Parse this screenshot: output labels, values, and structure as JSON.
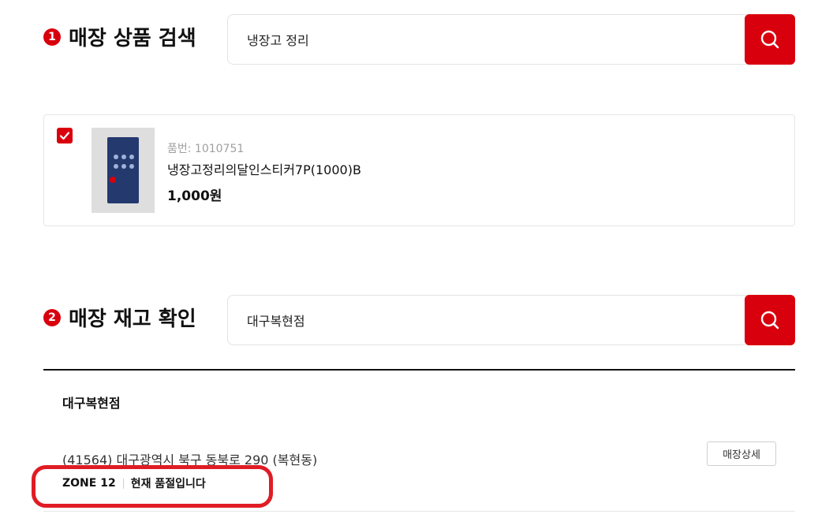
{
  "search_section": {
    "step": "1",
    "title": "매장 상품 검색",
    "query": "냉장고 정리"
  },
  "product": {
    "code": "품번: 1010751",
    "name": "냉장고정리의달인스티커7P(1000)B",
    "price": "1,000원",
    "checked": true
  },
  "stock_section": {
    "step": "2",
    "title": "매장 재고 확인",
    "query": "대구복현점"
  },
  "store": {
    "name": "대구복현점",
    "address": "(41564) 대구광역시 북구 동북로 290 (복현동)",
    "detail_label": "매장상세",
    "zone": "ZONE 12",
    "stock_status": "현재 품절입니다"
  },
  "colors": {
    "accent": "#d9000d",
    "highlight": "#e01c24"
  },
  "icons": {
    "search": "search-icon",
    "check": "check-icon"
  }
}
